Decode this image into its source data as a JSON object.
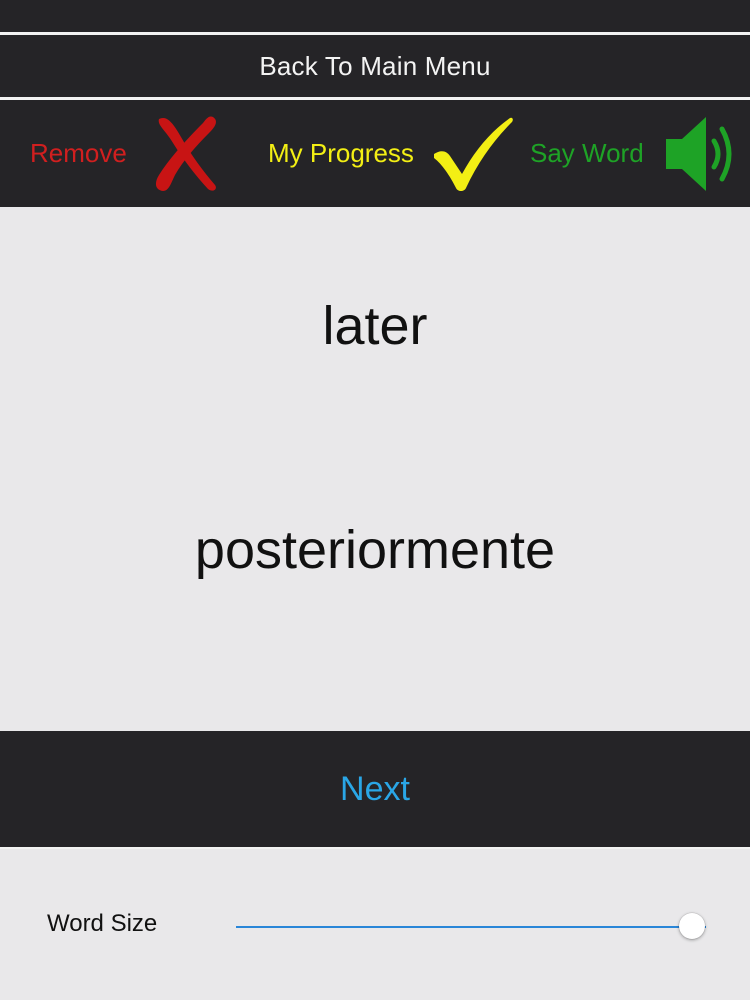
{
  "menu": {
    "back_label": "Back To Main Menu"
  },
  "toolbar": {
    "remove": {
      "label": "Remove",
      "icon": "x-mark-icon",
      "color": "#d11f1f"
    },
    "progress": {
      "label": "My Progress",
      "icon": "checkmark-icon",
      "color": "#f3ef14"
    },
    "say_word": {
      "label": "Say Word",
      "icon": "speaker-icon",
      "color": "#1ea326"
    }
  },
  "card": {
    "word": "later",
    "translation": "posteriormente"
  },
  "next": {
    "label": "Next",
    "color": "#2aa6e6"
  },
  "settings": {
    "word_size_label": "Word Size",
    "word_size_fraction": 0.97
  }
}
